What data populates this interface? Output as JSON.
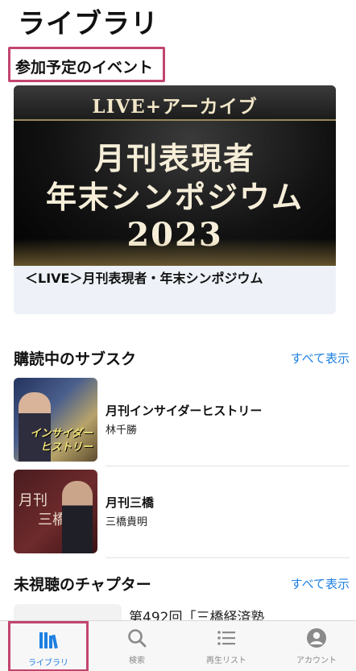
{
  "page": {
    "title": "ライブラリ"
  },
  "events_section": {
    "header": "参加予定のイベント",
    "card": {
      "banner_top": "LIVE+アーカイブ",
      "banner_line1": "月刊表現者",
      "banner_line2": "年末シンポジウム",
      "banner_line3": "2023",
      "title": "＜LIVE＞月刊表現者・年末シンポジウム"
    }
  },
  "subscriptions": {
    "header": "購読中のサブスク",
    "see_all": "すべて表示",
    "items": [
      {
        "name": "月刊インサイダーヒストリー",
        "author": "林千勝",
        "thumb_text1": "インサイダー",
        "thumb_text2": "ヒストリー"
      },
      {
        "name": "月刊三橋",
        "author": "三橋貴明",
        "thumb_text1": "月刊",
        "thumb_text2": "三橋"
      }
    ]
  },
  "unwatched": {
    "header": "未視聴のチャプター",
    "see_all": "すべて表示",
    "first_item_title": "第492回「三橋経済塾"
  },
  "tabbar": {
    "items": [
      {
        "label": "ライブラリ",
        "icon": "library-icon",
        "active": true
      },
      {
        "label": "検索",
        "icon": "search-icon",
        "active": false
      },
      {
        "label": "再生リスト",
        "icon": "list-icon",
        "active": false
      },
      {
        "label": "アカウント",
        "icon": "account-icon",
        "active": false
      }
    ],
    "active_color": "#1e7fe0",
    "inactive_color": "#8a8a8a"
  },
  "colors": {
    "accent": "#1e7fe0",
    "highlight_border": "#c2456e"
  }
}
